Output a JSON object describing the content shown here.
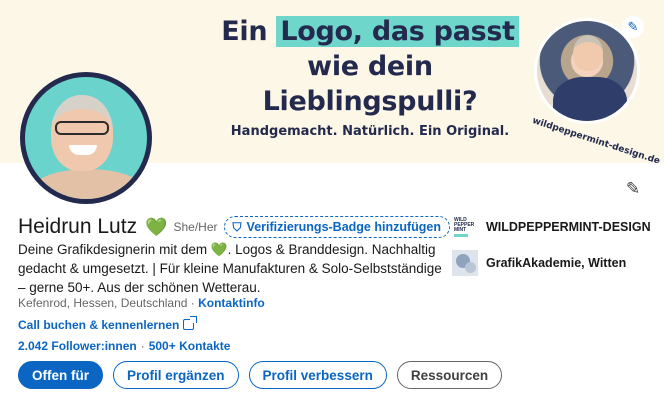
{
  "banner": {
    "headline_prefix": "Ein ",
    "headline_highlight": "Logo, das passt",
    "headline_line2": "wie dein",
    "headline_line3": "Lieblingspulli?",
    "subline": "Handgemacht. Natürlich. Ein Original.",
    "url": "wildpeppermint-design.de",
    "edit_icon": "pencil-icon",
    "highlight_color": "#6fd6cc"
  },
  "profile": {
    "name": "Heidrun Lutz",
    "heart_emoji": "💚",
    "pronouns": "She/Her",
    "verify_badge": "Verifizierungs-Badge hinzufügen",
    "headline_part1": "Deine Grafikdesignerin mit dem ",
    "headline_heart": "💚",
    "headline_part2": ". Logos & Branddesign. Nachhaltig gedacht & umgesetzt. | Für kleine Manufakturen & Solo-Selbstständige – gerne 50+. Aus der schönen Wetterau.",
    "location": "Kefenrod, Hessen, Deutschland",
    "location_sep": " · ",
    "contact_info": "Kontaktinfo",
    "call_link": "Call buchen & kennenlernen",
    "followers": "2.042 Follower:innen",
    "followers_sep": "·",
    "connections": "500+ Kontakte"
  },
  "buttons": {
    "open_for": "Offen für",
    "add_section": "Profil ergänzen",
    "improve": "Profil verbessern",
    "resources": "Ressourcen"
  },
  "organizations": [
    {
      "name": "WILDPEPPERMINT-DESIGN",
      "logo_text": "WILD PEPPER MINT"
    },
    {
      "name": "GrafikAkademie, Witten"
    }
  ],
  "colors": {
    "accent": "#0a66c2",
    "banner_bg": "#fcf7e6",
    "navy": "#232a4d",
    "teal": "#69d3cc"
  }
}
